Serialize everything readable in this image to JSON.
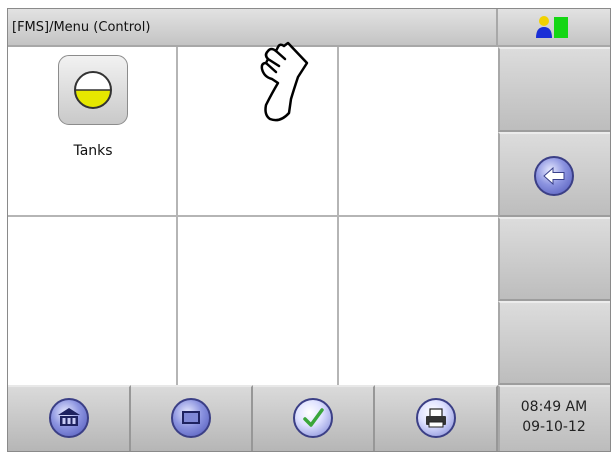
{
  "window": {
    "title": "[FMS]/Menu (Control)"
  },
  "status": {
    "indicator_icon": "user-status-icon",
    "colors": {
      "person": "#1a2fd6",
      "head": "#f1d200",
      "box": "#14d614"
    }
  },
  "menu": {
    "tiles": [
      {
        "label": "Tanks",
        "icon": "tank-icon",
        "fill_level": 0.5
      }
    ]
  },
  "side_panel": {
    "back_icon": "back-arrow-icon"
  },
  "bottom_bar": {
    "buttons": [
      {
        "icon": "building-icon"
      },
      {
        "icon": "display-icon"
      },
      {
        "icon": "checkmark-icon"
      },
      {
        "icon": "printer-icon"
      }
    ]
  },
  "clock": {
    "time": "08:49 AM",
    "date": "09-10-12"
  },
  "colors": {
    "panel_gray": "#c4c4c4",
    "icon_blue": "#5a62c4",
    "tank_yellow": "#e6e800",
    "check_green": "#3aa63a"
  }
}
